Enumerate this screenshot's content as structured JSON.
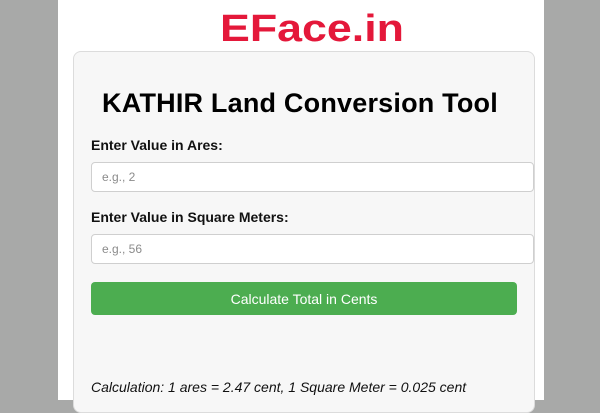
{
  "brand": {
    "logo_text": "EFace.in",
    "logo_color": "#e4183a"
  },
  "tool": {
    "title": "KATHIR Land Conversion Tool",
    "ares_label": "Enter Value in Ares:",
    "ares_placeholder": "e.g., 2",
    "sqm_label": "Enter Value in Square Meters:",
    "sqm_placeholder": "e.g., 56",
    "button_label": "Calculate Total in Cents",
    "button_color": "#4cad50",
    "note": "Calculation: 1 ares = 2.47 cent, 1 Square Meter = 0.025 cent"
  }
}
